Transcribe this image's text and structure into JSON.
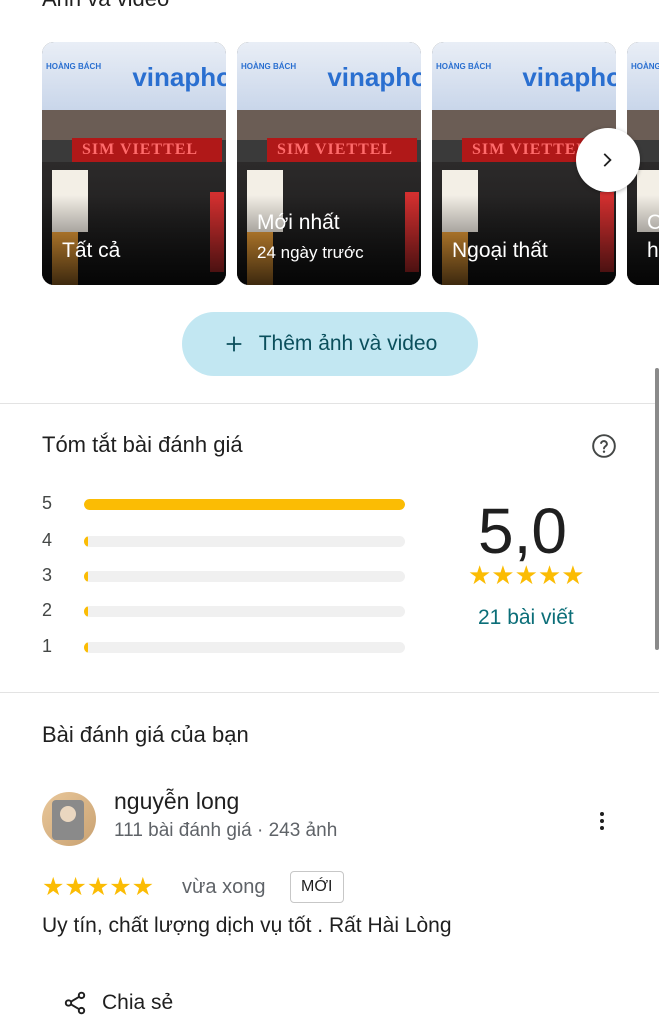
{
  "photos_section": {
    "title": "Ảnh và video"
  },
  "photo_tiles": [
    {
      "caption": "Tất cả",
      "sub": ""
    },
    {
      "caption": "Mới nhất",
      "sub": "24 ngày trước"
    },
    {
      "caption": "Ngoại thất",
      "sub": ""
    },
    {
      "caption": "C",
      "sub": "h"
    }
  ],
  "photo_sign": {
    "brand": "vinapho",
    "store": "HOÀNG BÁCH",
    "banner": "SIM VIETTEL"
  },
  "add_media": {
    "label": "Thêm ảnh và video"
  },
  "summary": {
    "title": "Tóm tắt bài đánh giá",
    "rating": "5,0",
    "stars": "★★★★★",
    "count": "21 bài viết",
    "distribution": [
      {
        "label": "5",
        "fraction": 1.0
      },
      {
        "label": "4",
        "fraction": 0.0
      },
      {
        "label": "3",
        "fraction": 0.0
      },
      {
        "label": "2",
        "fraction": 0.0
      },
      {
        "label": "1",
        "fraction": 0.0
      }
    ]
  },
  "your_review": {
    "title": "Bài đánh giá của bạn",
    "reviewer_name": "nguyễn long",
    "reviewer_meta": "111 bài đánh giá · 243 ảnh",
    "stars": "★★★★★",
    "time": "vừa xong",
    "badge": "MỚI",
    "text": "Uy tín, chất lượng dịch vụ tốt . Rất Hài Lòng",
    "share_label": "Chia sẻ"
  },
  "colors": {
    "star": "#fbbc04",
    "accent": "#0b6e78",
    "chip_bg": "#c2e7f2"
  }
}
